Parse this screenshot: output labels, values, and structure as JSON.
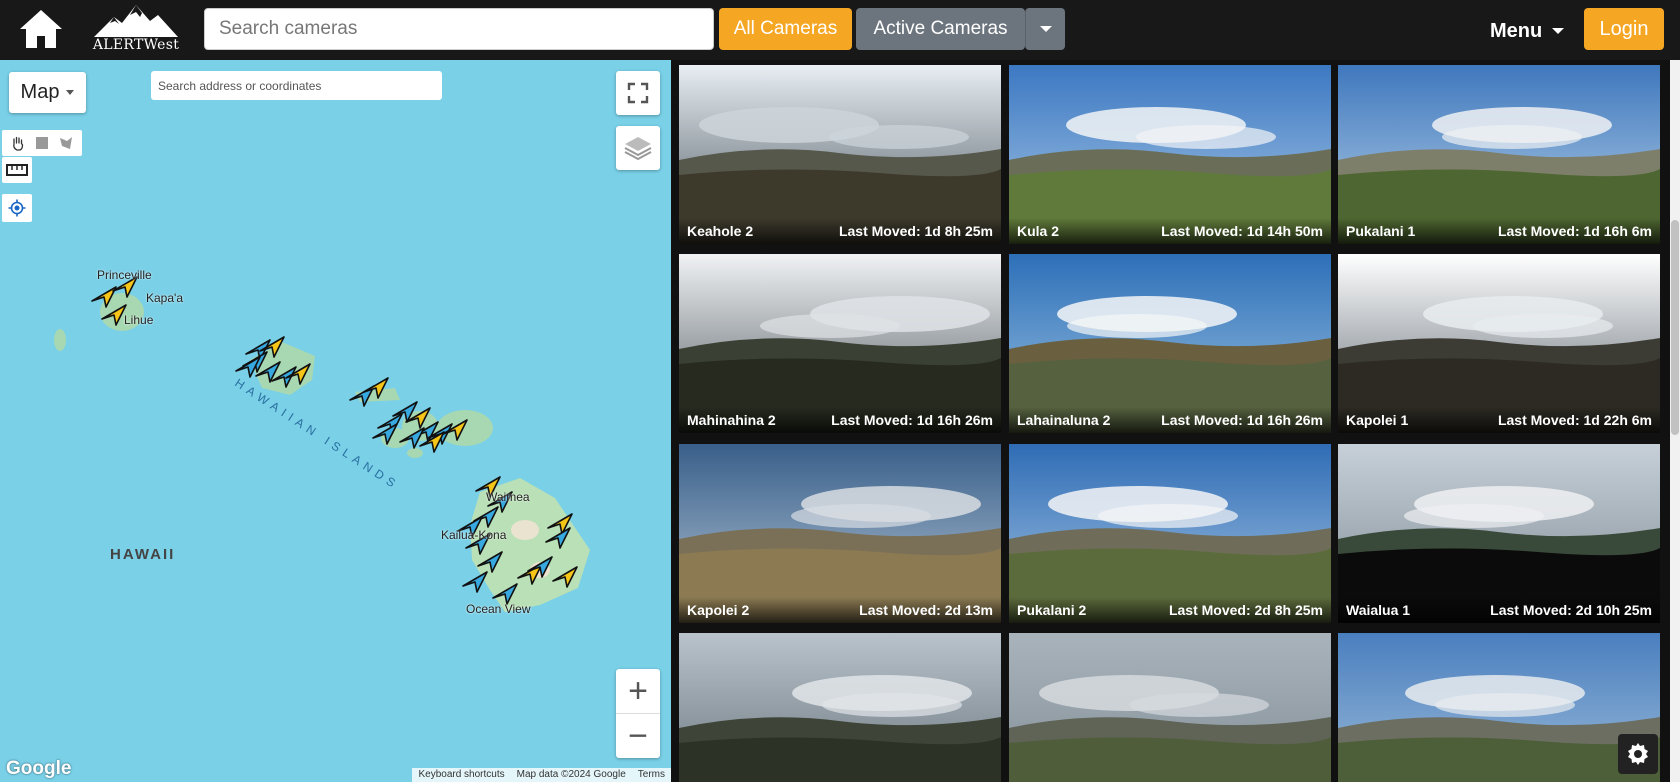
{
  "header": {
    "logo_text": "ALERTWest",
    "search_placeholder": "Search cameras",
    "all_cameras_label": "All Cameras",
    "active_cameras_label": "Active Cameras",
    "menu_label": "Menu",
    "login_label": "Login",
    "accent_color": "#f5a623",
    "secondary_color": "#6c757d"
  },
  "map": {
    "type_label": "Map",
    "address_placeholder": "Search address or coordinates",
    "labels": {
      "princeville": "Princeville",
      "kapaa": "Kapa'a",
      "lihue": "Lihue",
      "hawaiian_islands": "HAWAIIAN ISLANDS",
      "waimea": "Waimea",
      "kailua_kona": "Kailua-Kona",
      "ocean_view": "Ocean View",
      "hawaii": "HAWAII"
    },
    "google": "Google",
    "attribution": [
      "Keyboard shortcuts",
      "Map data ©2024 Google",
      "Terms"
    ],
    "ocean_color": "#79d0e7",
    "marker_colors": {
      "active": "#38a9e0",
      "alert": "#f5c518"
    }
  },
  "cameras": [
    {
      "name": "Keahole 2",
      "last_moved": "Last Moved: 1d 8h 25m"
    },
    {
      "name": "Kula 2",
      "last_moved": "Last Moved: 1d 14h 50m"
    },
    {
      "name": "Pukalani 1",
      "last_moved": "Last Moved: 1d 16h 6m"
    },
    {
      "name": "Mahinahina 2",
      "last_moved": "Last Moved: 1d 16h 26m"
    },
    {
      "name": "Lahainaluna 2",
      "last_moved": "Last Moved: 1d 16h 26m"
    },
    {
      "name": "Kapolei 1",
      "last_moved": "Last Moved: 1d 22h 6m"
    },
    {
      "name": "Kapolei 2",
      "last_moved": "Last Moved: 2d 13m"
    },
    {
      "name": "Pukalani 2",
      "last_moved": "Last Moved: 2d 8h 25m"
    },
    {
      "name": "Waialua 1",
      "last_moved": "Last Moved: 2d 10h 25m"
    },
    {
      "name": "",
      "last_moved": ""
    },
    {
      "name": "",
      "last_moved": ""
    },
    {
      "name": "",
      "last_moved": ""
    }
  ]
}
